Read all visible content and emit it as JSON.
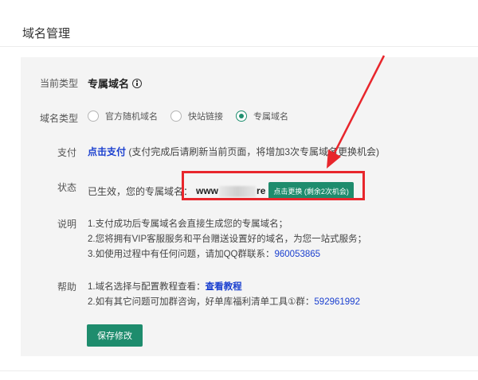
{
  "header": {
    "title": "域名管理"
  },
  "current_type": {
    "label": "当前类型",
    "value": "专属域名"
  },
  "domain_type": {
    "label": "域名类型",
    "options": [
      {
        "label": "官方随机域名",
        "selected": false
      },
      {
        "label": "快站链接",
        "selected": false
      },
      {
        "label": "专属域名",
        "selected": true
      }
    ]
  },
  "payment": {
    "label": "支付",
    "link_text": "点击支付",
    "note": "(支付完成后请刷新当前页面，将增加3次专属域名更换机会)"
  },
  "status": {
    "label": "状态",
    "text": "已生效，您的专属域名：",
    "domain_prefix": "www",
    "domain_suffix": "re",
    "replace_button": "点击更换 (剩余2次机会)"
  },
  "description": {
    "label": "说明",
    "line1": "1.支付成功后专属域名会直接生成您的专属域名；",
    "line2": "2.您将拥有VIP客服服务和平台赠送设置好的域名，为您一站式服务；",
    "line3_text": "3.如使用过程中有任何问题，请加QQ群联系：",
    "line3_number": "960053865"
  },
  "help": {
    "label": "帮助",
    "line1_text": "1.域名选择与配置教程查看：",
    "line1_link": "查看教程",
    "line2_text": "2.如有其它问题可加群咨询，好单库福利清单工具①群：",
    "line2_number": "592961992"
  },
  "save_button": "保存修改",
  "colors": {
    "accent": "#1e8c6d",
    "link": "#1a3fcf",
    "annotation": "#e8262c"
  }
}
